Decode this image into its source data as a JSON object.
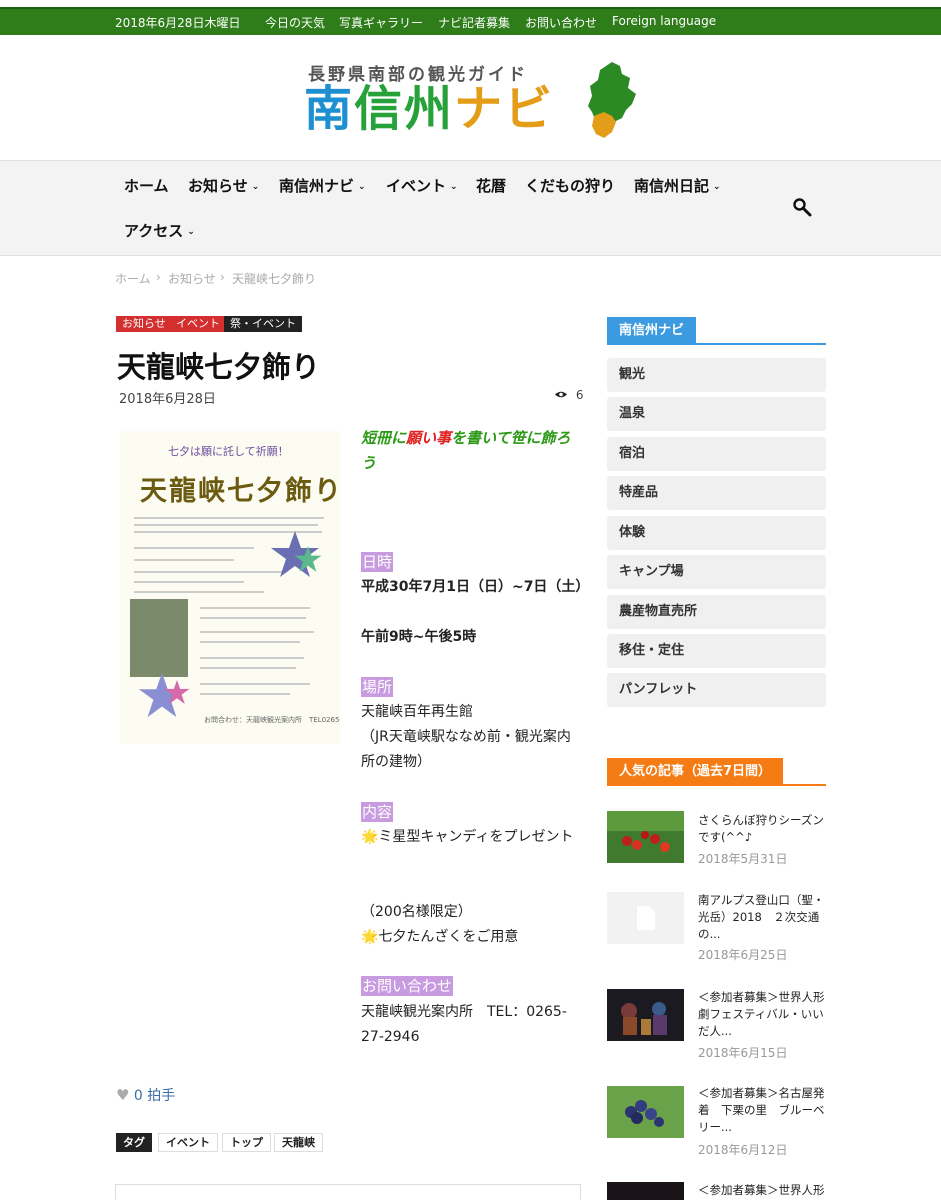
{
  "topbar": {
    "date": "2018年6月28日木曜日",
    "links": [
      "今日の天気",
      "写真ギャラリー",
      "ナビ記者募集",
      "お問い合わせ",
      "Foreign language"
    ]
  },
  "logo": {
    "subtitle": "長野県南部の観光ガイド",
    "name_part1": "南",
    "name_part2": "信州",
    "name_part3": "ナビ"
  },
  "nav": {
    "items": [
      "ホーム",
      "お知らせ",
      "南信州ナビ",
      "イベント",
      "花暦",
      "くだもの狩り",
      "南信州日記",
      "アクセス"
    ],
    "chevron": "⌄"
  },
  "breadcrumb": {
    "items": [
      "ホーム",
      "お知らせ",
      "天龍峡七夕飾り"
    ],
    "sep": "›"
  },
  "article": {
    "tags": [
      "お知らせ",
      "イベント",
      "祭・イベント"
    ],
    "tag_colors": [
      "#d32f2f",
      "#d32f2f",
      "#222222"
    ],
    "title": "天龍峡七夕飾り",
    "date": "2018年6月28日",
    "views": "6",
    "poster": {
      "top_text": "七夕は願に託して祈願！",
      "title": "天龍峡七夕飾り",
      "footer": "お問合わせ：天龍峡観光案内所　TEL0265-27-2946"
    },
    "lead_part1": "短冊に",
    "lead_red": "願い事",
    "lead_part2": "を書いて笹に飾ろう",
    "sections": {
      "datetime_label": "日時",
      "datetime_line1": "平成30年7月1日（日）~7日（土）",
      "datetime_line2": "午前9時~午後5時",
      "place_label": "場所",
      "place_line1": "天龍峡百年再生館",
      "place_line2": "（JR天竜峡駅ななめ前・観光案内所の建物）",
      "content_label": "内容",
      "content_line1": "🌟ミ星型キャンディをプレゼント",
      "content_line2": "（200名様限定）",
      "content_line3": "🌟七夕たんざくをご用意",
      "contact_label": "お問い合わせ",
      "contact_line": "天龍峡観光案内所　TEL：0265-27-2946"
    },
    "likes": "0 拍手",
    "tag_label": "タグ",
    "tag_list": [
      "イベント",
      "トップ",
      "天龍峡"
    ]
  },
  "sidebar": {
    "heading": "南信州ナビ",
    "categories": [
      "観光",
      "温泉",
      "宿泊",
      "特産品",
      "体験",
      "キャンプ場",
      "農産物直売所",
      "移住・定住",
      "パンフレット"
    ],
    "popular_heading": "人気の記事（過去7日間）",
    "popular": [
      {
        "title": "さくらんぼ狩りシーズンです(^^♪",
        "date": "2018年5月31日"
      },
      {
        "title": "南アルプス登山口（聖・光岳）2018　２次交通の...",
        "date": "2018年6月25日"
      },
      {
        "title": "＜参加者募集＞世界人形劇フェスティバル・いいだ人...",
        "date": "2018年6月15日"
      },
      {
        "title": "＜参加者募集＞名古屋発着　下栗の里　ブルーベリー...",
        "date": "2018年6月12日"
      },
      {
        "title": "＜参加者募集＞世界人形",
        "date": ""
      }
    ]
  },
  "colors": {
    "topbar": "#2e7d1a",
    "sidebar_heading": "#3b9ae0",
    "popular_heading": "#f57b14",
    "highlight": "#c89ae0"
  }
}
